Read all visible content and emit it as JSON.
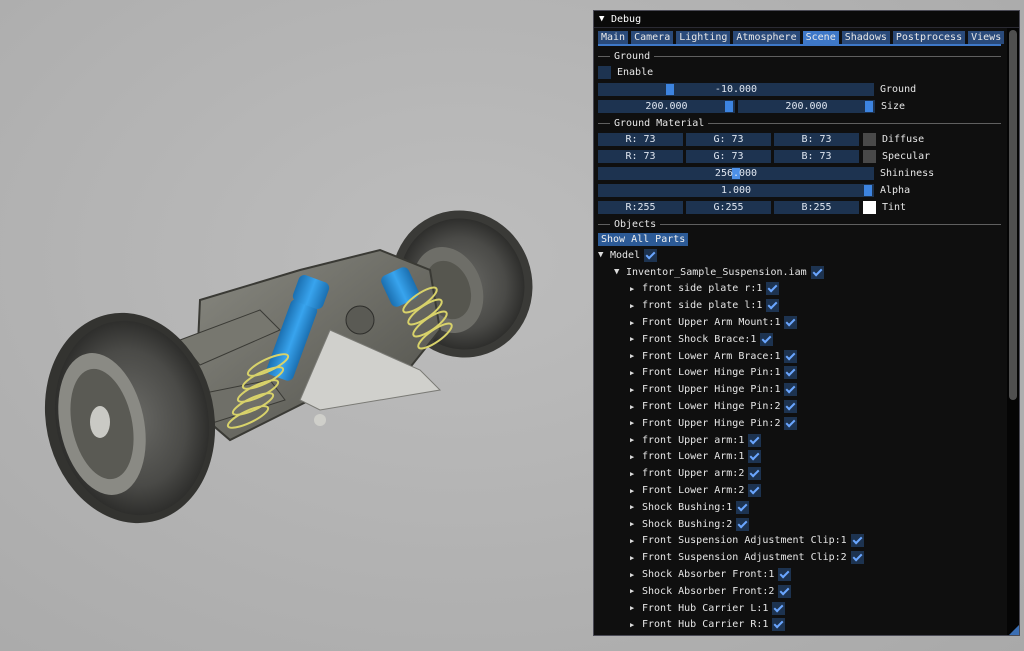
{
  "window": {
    "title": "Debug"
  },
  "tabs": [
    "Main",
    "Camera",
    "Lighting",
    "Atmosphere",
    "Scene",
    "Shadows",
    "Postprocess",
    "Views"
  ],
  "active_tab": "Scene",
  "ground": {
    "header": "Ground",
    "enable_label": "Enable",
    "ground_value": "-10.000",
    "ground_label": "Ground",
    "size_x": "200.000",
    "size_y": "200.000",
    "size_label": "Size"
  },
  "material": {
    "header": "Ground Material",
    "diffuse": {
      "r": "R: 73",
      "g": "G: 73",
      "b": "B: 73",
      "label": "Diffuse"
    },
    "specular": {
      "r": "R: 73",
      "g": "G: 73",
      "b": "B: 73",
      "label": "Specular"
    },
    "shininess": {
      "value": "256.000",
      "label": "Shininess"
    },
    "alpha": {
      "value": "1.000",
      "label": "Alpha"
    },
    "tint": {
      "r": "R:255",
      "g": "G:255",
      "b": "B:255",
      "label": "Tint"
    }
  },
  "objects": {
    "header": "Objects",
    "show_all": "Show All Parts",
    "model": "Model",
    "assembly": "Inventor_Sample_Suspension.iam",
    "parts": [
      "front side plate r:1",
      "front side plate l:1",
      "Front Upper Arm Mount:1",
      "Front Shock Brace:1",
      "Front Lower Arm Brace:1",
      "Front Lower Hinge Pin:1",
      "Front Upper Hinge Pin:1",
      "Front Lower Hinge Pin:2",
      "Front Upper Hinge Pin:2",
      "front Upper arm:1",
      "front Lower Arm:1",
      "front Upper arm:2",
      "Front Lower Arm:2",
      "Shock Bushing:1",
      "Shock Bushing:2",
      "Front Suspension Adjustment Clip:1",
      "Front Suspension Adjustment Clip:2",
      "Shock Absorber Front:1",
      "Shock Absorber Front:2",
      "Front Hub Carrier L:1",
      "Front Hub Carrier R:1"
    ]
  },
  "colors": {
    "accent": "#3e78c8",
    "frame_bg": "#1d3350",
    "window_bg": "#0f0f0f",
    "diffuse_swatch": "#494949",
    "specular_swatch": "#494949",
    "tint_swatch": "#ffffff",
    "shock_blue": "#2a8fd8"
  },
  "icons": {
    "collapse": "triangle-down-icon",
    "expand": "triangle-right-icon",
    "check": "checkmark-icon"
  }
}
